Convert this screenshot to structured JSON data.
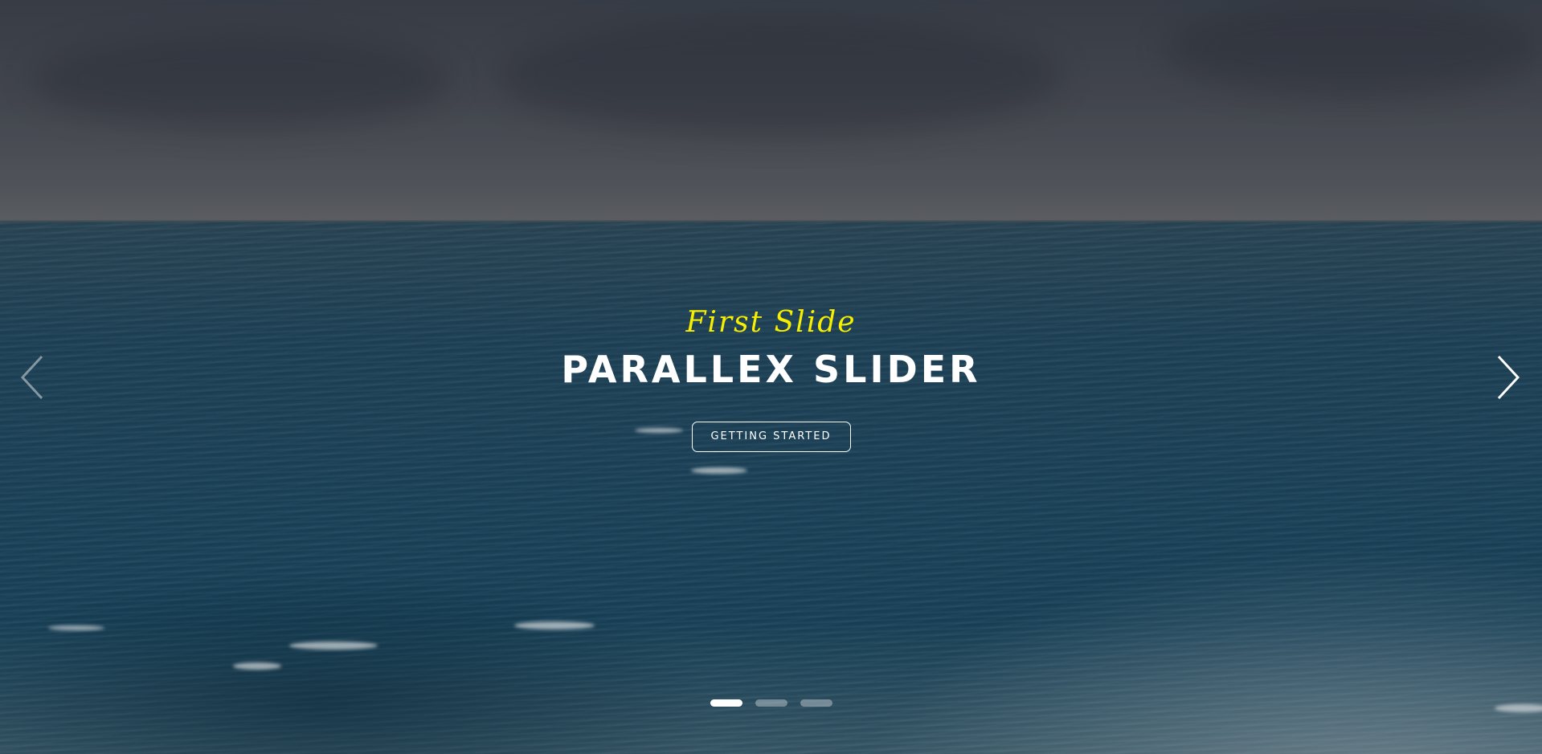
{
  "slider": {
    "slides": [
      {
        "subtitle": "First Slide",
        "title": "PARALLEX SLIDER",
        "button_label": "GETTING STARTED",
        "active": true
      },
      {
        "active": false
      },
      {
        "active": false
      }
    ],
    "prev_icon": "chevron-left-icon",
    "next_icon": "chevron-right-icon"
  },
  "colors": {
    "subtitle": "#f7ee00",
    "title": "#ffffff",
    "button_border": "#ffffff",
    "dot_active": "#ffffff"
  }
}
